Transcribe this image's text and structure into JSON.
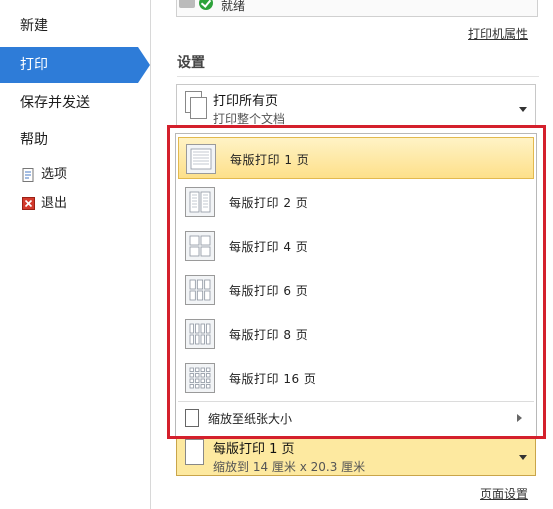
{
  "nav": {
    "new": "新建",
    "print": "打印",
    "save_send": "保存并发送",
    "help": "帮助",
    "options": "选项",
    "exit": "退出"
  },
  "printer": {
    "status": "就绪",
    "properties_link": "打印机属性"
  },
  "settings": {
    "heading": "设置",
    "print_what": {
      "title": "打印所有页",
      "subtitle": "打印整个文档"
    },
    "pages_per_sheet_menu": [
      {
        "label": "每版打印 1 页",
        "selected": true,
        "grid": [
          1,
          1
        ]
      },
      {
        "label": "每版打印 2 页",
        "selected": false,
        "grid": [
          2,
          1
        ]
      },
      {
        "label": "每版打印 4 页",
        "selected": false,
        "grid": [
          2,
          2
        ]
      },
      {
        "label": "每版打印 6 页",
        "selected": false,
        "grid": [
          3,
          2
        ]
      },
      {
        "label": "每版打印 8 页",
        "selected": false,
        "grid": [
          4,
          2
        ]
      },
      {
        "label": "每版打印 16 页",
        "selected": false,
        "grid": [
          4,
          4
        ]
      }
    ],
    "scale_to_paper": "缩放至纸张大小",
    "current": {
      "title": "每版打印 1 页",
      "subtitle": "缩放到 14 厘米 x 20.3 厘米"
    },
    "page_setup_link": "页面设置"
  },
  "colors": {
    "accent": "#2e7cd8",
    "highlight": "#d4202c"
  }
}
